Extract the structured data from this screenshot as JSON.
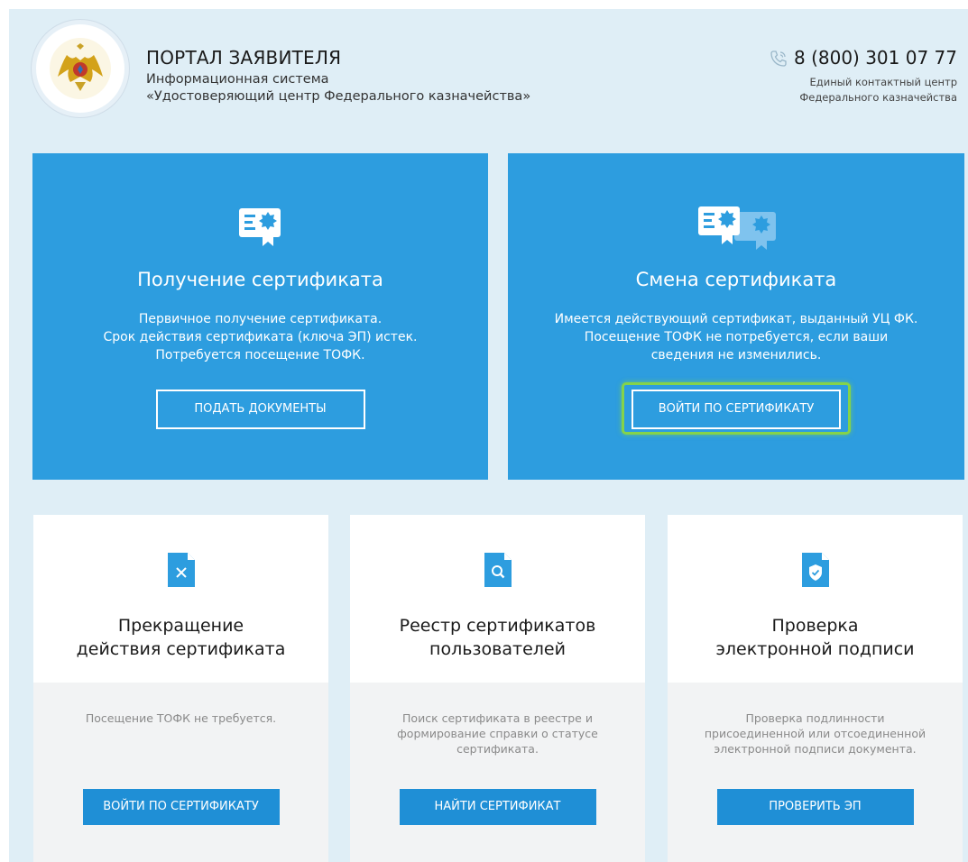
{
  "header": {
    "title": "ПОРТАЛ ЗАЯВИТЕЛЯ",
    "subtitle_line1": "Информационная система",
    "subtitle_line2": "«Удостоверяющий центр Федерального казначейства»",
    "phone": "8 (800) 301 07 77",
    "contact_line1": "Единый контактный центр",
    "contact_line2": "Федерального казначейства"
  },
  "tiles": [
    {
      "title": "Получение сертификата",
      "description": [
        "Первичное получение сертификата.",
        "Срок действия сертификата (ключа ЭП) истек.",
        "Потребуется посещение ТОФК."
      ],
      "button": "ПОДАТЬ ДОКУМЕНТЫ",
      "icon": "certificate-icon"
    },
    {
      "title": "Смена сертификата",
      "description": [
        "Имеется действующий сертификат, выданный УЦ ФК.",
        "Посещение ТОФК не потребуется, если ваши",
        "сведения не изменились."
      ],
      "button": "ВОЙТИ ПО СЕРТИФИКАТУ",
      "icon": "certificate-renew-icon",
      "highlighted": true
    }
  ],
  "cards": [
    {
      "title_line1": "Прекращение",
      "title_line2": "действия сертификата",
      "description": [
        "Посещение ТОФК не требуется."
      ],
      "button": "ВОЙТИ ПО СЕРТИФИКАТУ",
      "icon": "document-cross-icon"
    },
    {
      "title_line1": "Реестр сертификатов",
      "title_line2": "пользователей",
      "description": [
        "Поиск сертификата в реестре и",
        "формирование справки о статусе",
        "сертификата."
      ],
      "button": "НАЙТИ СЕРТИФИКАТ",
      "icon": "document-search-icon"
    },
    {
      "title_line1": "Проверка",
      "title_line2": "электронной подписи",
      "description": [
        "Проверка подлинности",
        "присоединенной или отсоединенной",
        "электронной подписи документа."
      ],
      "button": "ПРОВЕРИТЬ ЭП",
      "icon": "document-shield-icon"
    }
  ],
  "colors": {
    "page_background": "#dfeef6",
    "tile_blue": "#2d9ddf",
    "button_blue": "#1f8fd6",
    "highlight_green": "#84d34a",
    "card_bottom": "#f2f3f4"
  }
}
